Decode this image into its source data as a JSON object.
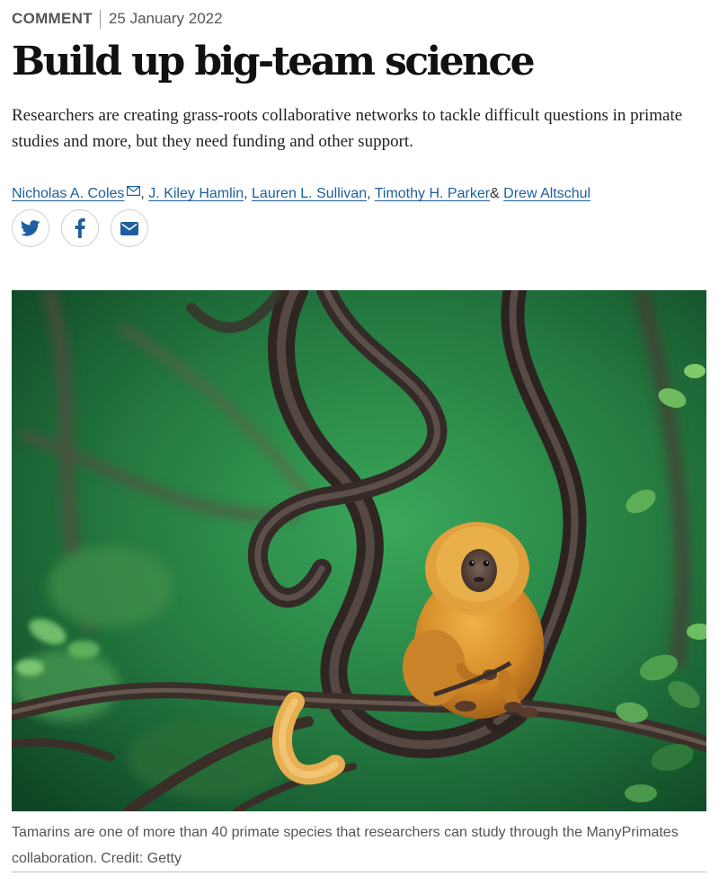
{
  "article": {
    "type": "COMMENT",
    "date": "25 January 2022",
    "title": "Build up big-team science",
    "standfirst": "Researchers are creating grass-roots collaborative networks to tackle difficult questions in primate studies and more, but they need funding and other support.",
    "authors": [
      {
        "name": "Nicholas A. Coles",
        "corresponding": true
      },
      {
        "name": "J. Kiley Hamlin"
      },
      {
        "name": "Lauren L. Sullivan"
      },
      {
        "name": "Timothy H. Parker"
      },
      {
        "name": "Drew Altschul"
      }
    ],
    "author_separator": ",",
    "author_last_separator": "&"
  },
  "share": {
    "buttons": [
      {
        "icon": "twitter-icon"
      },
      {
        "icon": "facebook-icon"
      },
      {
        "icon": "email-icon"
      }
    ],
    "color": "#1d5f9e"
  },
  "figure": {
    "subject": "golden lion tamarin sitting on a branch among tangled vines, green forest background",
    "caption": "Tamarins are one of more than 40 primate species that researchers can study through the ManyPrimates collaboration.",
    "credit": "Credit: Getty"
  },
  "colors": {
    "link": "#1d5f9e",
    "headline": "#111111",
    "meta": "#555555",
    "foliage": "#2f8f4a",
    "fur": "#d9952f"
  }
}
